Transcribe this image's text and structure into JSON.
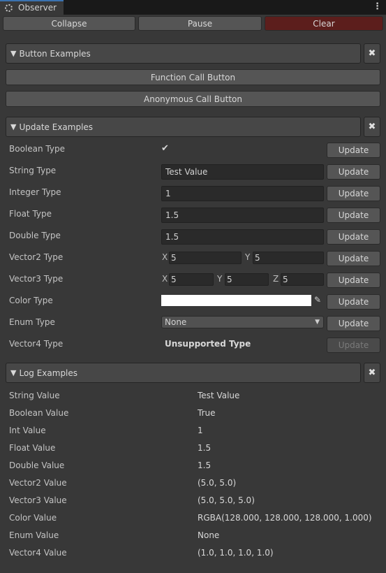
{
  "window": {
    "tab_title": "Observer",
    "tab_icon": "observer-icon",
    "menu_icon": "kebab-menu-icon"
  },
  "toolbar": {
    "collapse_label": "Collapse",
    "pause_label": "Pause",
    "clear_label": "Clear"
  },
  "colors": {
    "clear_button_bg": "#5c1e1c",
    "panel_bg": "#383838",
    "tab_accent": "#3a72b0"
  },
  "button_examples": {
    "title": "Button Examples",
    "close_icon": "close-icon",
    "buttons": [
      "Function Call Button",
      "Anonymous Call Button"
    ]
  },
  "update_examples": {
    "title": "Update Examples",
    "update_label": "Update",
    "rows": {
      "boolean": {
        "label": "Boolean Type",
        "checked": true,
        "check_glyph": "✔"
      },
      "string": {
        "label": "String Type",
        "value": "Test Value"
      },
      "integer": {
        "label": "Integer Type",
        "value": "1"
      },
      "float": {
        "label": "Float Type",
        "value": "1.5"
      },
      "double": {
        "label": "Double Type",
        "value": "1.5"
      },
      "vector2": {
        "label": "Vector2 Type",
        "x_axis": "X",
        "x": "5",
        "y_axis": "Y",
        "y": "5"
      },
      "vector3": {
        "label": "Vector3 Type",
        "x_axis": "X",
        "x": "5",
        "y_axis": "Y",
        "y": "5",
        "z_axis": "Z",
        "z": "5"
      },
      "color": {
        "label": "Color Type",
        "value": "#ffffff",
        "picker_icon": "eyedropper-icon"
      },
      "enum": {
        "label": "Enum Type",
        "selected": "None"
      },
      "vector4": {
        "label": "Vector4 Type",
        "value": "Unsupported Type"
      }
    }
  },
  "log_examples": {
    "title": "Log Examples",
    "rows": [
      {
        "label": "String Value",
        "value": "Test Value"
      },
      {
        "label": "Boolean Value",
        "value": "True"
      },
      {
        "label": "Int Value",
        "value": "1"
      },
      {
        "label": "Float Value",
        "value": "1.5"
      },
      {
        "label": "Double Value",
        "value": "1.5"
      },
      {
        "label": "Vector2 Value",
        "value": "(5.0, 5.0)"
      },
      {
        "label": "Vector3 Value",
        "value": "(5.0, 5.0, 5.0)"
      },
      {
        "label": "Color Value",
        "value": "RGBA(128.000, 128.000, 128.000, 1.000)"
      },
      {
        "label": "Enum Value",
        "value": "None"
      },
      {
        "label": "Vector4 Value",
        "value": "(1.0, 1.0, 1.0, 1.0)"
      }
    ]
  }
}
